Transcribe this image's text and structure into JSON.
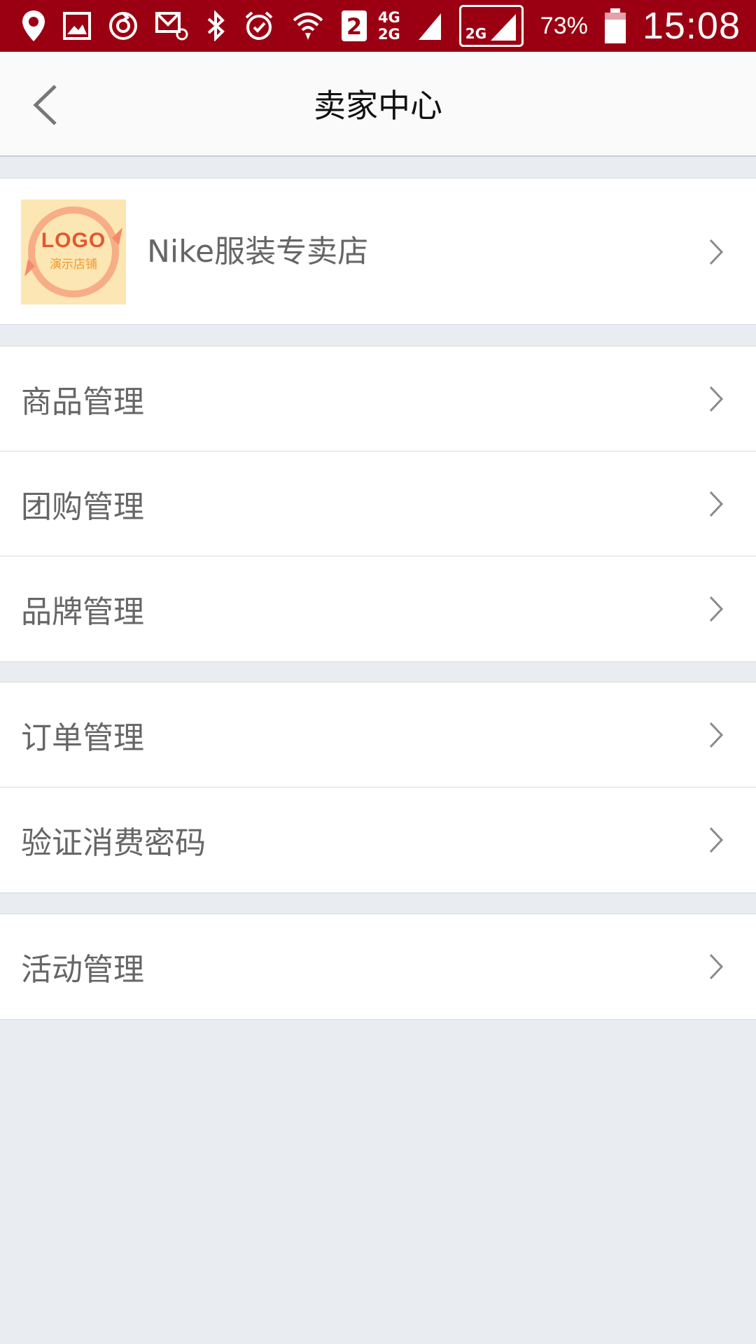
{
  "status_bar": {
    "network_top": "4G",
    "network_bottom": "2G",
    "network_box": "2G",
    "sim_badge": "2",
    "battery": "73%",
    "time": "15:08"
  },
  "header": {
    "title": "卖家中心"
  },
  "store": {
    "logo_main": "LOGO",
    "logo_sub": "演示店铺",
    "name": "Nike服装专卖店"
  },
  "menu": {
    "group1": [
      {
        "label": "商品管理"
      },
      {
        "label": "团购管理"
      },
      {
        "label": "品牌管理"
      }
    ],
    "group2": [
      {
        "label": "订单管理"
      },
      {
        "label": "验证消费密码"
      }
    ],
    "group3": [
      {
        "label": "活动管理"
      }
    ]
  },
  "colors": {
    "status_bar": "#9b0012",
    "background": "#e9ecf1",
    "text": "#666666",
    "chevron": "#8a8a8a"
  }
}
